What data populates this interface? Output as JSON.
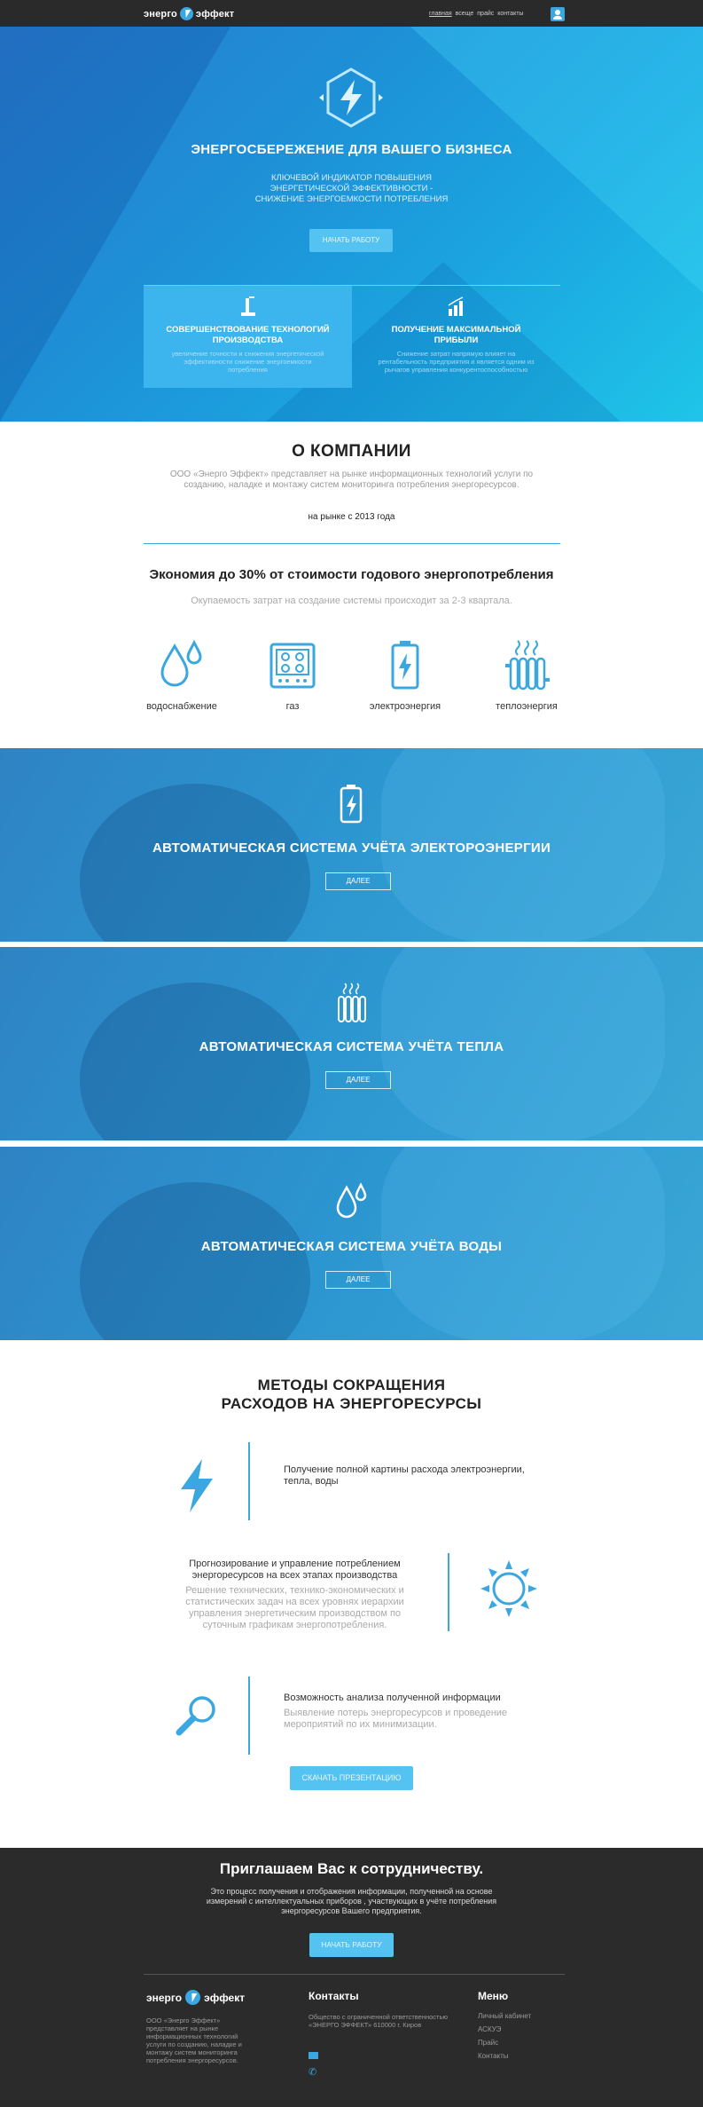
{
  "header": {
    "logo_left": "энерго",
    "logo_right": "эффект",
    "nav": [
      "главная",
      "всеще",
      "прайс",
      "контакты"
    ]
  },
  "hero": {
    "title": "ЭНЕРГОСБЕРЕЖЕНИЕ ДЛЯ ВАШЕГО БИЗНЕСА",
    "subtitle_lines": [
      "КЛЮЧЕВОЙ ИНДИКАТОР ПОВЫШЕНИЯ",
      "ЭНЕРГЕТИЧЕСКОЙ ЭФФЕКТИВНОСТИ -",
      "СНИЖЕНИЕ ЭНЕРГОЕМКОСТИ ПОТРЕБЛЕНИЯ"
    ],
    "button": "НАЧАТЬ РАБОТУ",
    "cards": [
      {
        "title": "СОВЕРШЕНСТВОВАНИЕ ТЕХНОЛОГИЙ ПРОИЗВОДСТВА",
        "text": "увеличение точности и снижения энергетической эффективности снижение энергоемкости потребления"
      },
      {
        "title": "ПОЛУЧЕНИЕ МАКСИМАЛЬНОЙ ПРИБЫЛИ",
        "text": "Снижение затрат напрямую влияет на рентабельность предприятия и является одним из рычагов управления конкурентоспособностью"
      }
    ]
  },
  "about": {
    "title": "О КОМПАНИИ",
    "text": "ООО «Энерго Эффект» представляет на рынке информационных технологий услуги по созданию, наладке и монтажу систем мониторинга потребления энергоресурсов.",
    "since": "на рынке с 2013 года",
    "saving_title": "Экономия до 30% от стоимости годового энергопотребления",
    "saving_text": "Окупаемость затрат на создание системы происходит за 2-3 квартала.",
    "resources": [
      "водоснабжение",
      "газ",
      "электроэнергия",
      "теплоэнергия"
    ]
  },
  "systems": [
    {
      "title": "АВТОМАТИЧЕСКАЯ СИСТЕМА УЧЁТА ЭЛЕКТОРОЭНЕРГИИ",
      "button": "ДАЛЕЕ",
      "icon": "battery-icon"
    },
    {
      "title": "АВТОМАТИЧЕСКАЯ СИСТЕМА УЧЁТА ТЕПЛА",
      "button": "ДАЛЕЕ",
      "icon": "radiator-icon"
    },
    {
      "title": "АВТОМАТИЧЕСКАЯ СИСТЕМА УЧЁТА ВОДЫ",
      "button": "ДАЛЕЕ",
      "icon": "water-drops-icon"
    }
  ],
  "methods": {
    "title_lines": [
      "МЕТОДЫ СОКРАЩЕНИЯ",
      "РАСХОДОВ НА ЭНЕРГОРЕСУРСЫ"
    ],
    "items": [
      {
        "heading": "Получение полной картины расхода электроэнергии, тепла, воды",
        "text": ""
      },
      {
        "heading": "Прогнозирование и управление потреблением энергоресурсов на всех этапах производства",
        "text": "Решение технических, технико-экономических и статистических задач на всех уровнях иерархии управления энергетическим производством по суточным графикам энергопотребления."
      },
      {
        "heading": "Возможность анализа полученной информации",
        "text": "Выявление потерь энергоресурсов и проведение мероприятий по их минимизации."
      }
    ],
    "button": "СКАЧАТЬ ПРЕЗЕНТАЦИЮ"
  },
  "cooperation": {
    "title": "Приглашаем Вас к сотрудничеству.",
    "text": "Это процесс получения и отображения информации, полученной на основе измерений с интеллектуальных приборов , участвующих в учёте потребления энергоресурсов Вашего предприятия.",
    "button": "НАЧАТЬ РАБОТУ"
  },
  "footer": {
    "logo_left": "энерго",
    "logo_right": "эффект",
    "about": "ООО «Энерго Эффект» представляет на рынке информационных технологий услуги по созданию, наладке и монтажу систем мониторинга потребления энергоресурсов.",
    "contacts_title": "Контакты",
    "contacts_text": "Общество с ограниченной ответственностью «ЭНЕРГО ЭФФЕКТ» 610000 г. Киров",
    "menu_title": "Меню",
    "menu": [
      "Личный кабинет",
      "АСКУЭ",
      "Прайс",
      "Контакты"
    ]
  },
  "colors": {
    "accent": "#3aa7e0",
    "dark": "#2b2b2b",
    "button": "#55c3f2"
  }
}
